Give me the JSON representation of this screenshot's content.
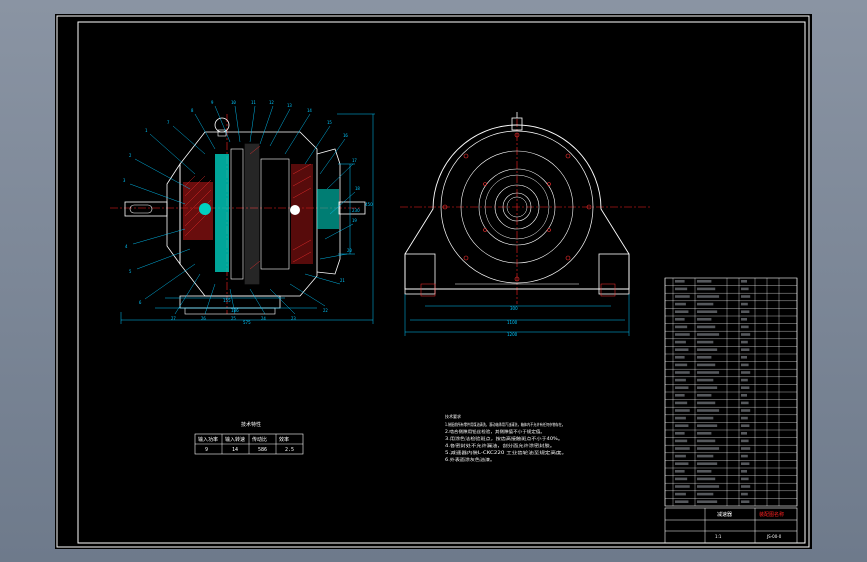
{
  "colors": {
    "background": "#000000",
    "border": "#ffffff",
    "part_outline": "#ffffff",
    "dimension": "#00c8ff",
    "centerline": "#ff2020",
    "hatch": "#ff3030",
    "teal_fill": "#00d0c0",
    "table_line": "#ffffff"
  },
  "views": {
    "section_view": "Cross-sectional view of reducer with balloons and dimensions",
    "front_view": "Front view of reducer housing"
  },
  "dimensions": {
    "section_bottom_1": "155",
    "section_bottom_2": "186",
    "section_bottom_3": "575",
    "section_right_1": "230",
    "section_right_2": "450",
    "front_bottom_1": "300",
    "front_bottom_2": "1100",
    "front_bottom_3": "1200"
  },
  "tech_table": {
    "title": "技术特性",
    "headers": [
      "输入功率",
      "输入转速",
      "传动比",
      "效率"
    ],
    "values": [
      "9",
      "14",
      "586",
      "2.5"
    ]
  },
  "notes": {
    "title": "技术要求",
    "lines": [
      "1.装配前所有零件用煤油清洗，滚动轴承用汽油清洗，箱体内不允许有任何杂物存在。",
      "2.啮合侧隙用铅丝检验，其侧隙值不小于规定值。",
      "3.用涂色法检验斑点，按齿高接触斑点不小于40%。",
      "4.各密封处不允许漏油，剖分面允许涂密封胶。",
      "5.减速器内装L-CKC220 工业齿轮油至规定高度。",
      "6.外表面涂灰色油漆。"
    ]
  },
  "bom": {
    "rows": 30,
    "title_block": {
      "name": "减速器",
      "drawing_no": "JS-00-0",
      "red_label": "装配图名称",
      "scale": "1:1"
    }
  }
}
